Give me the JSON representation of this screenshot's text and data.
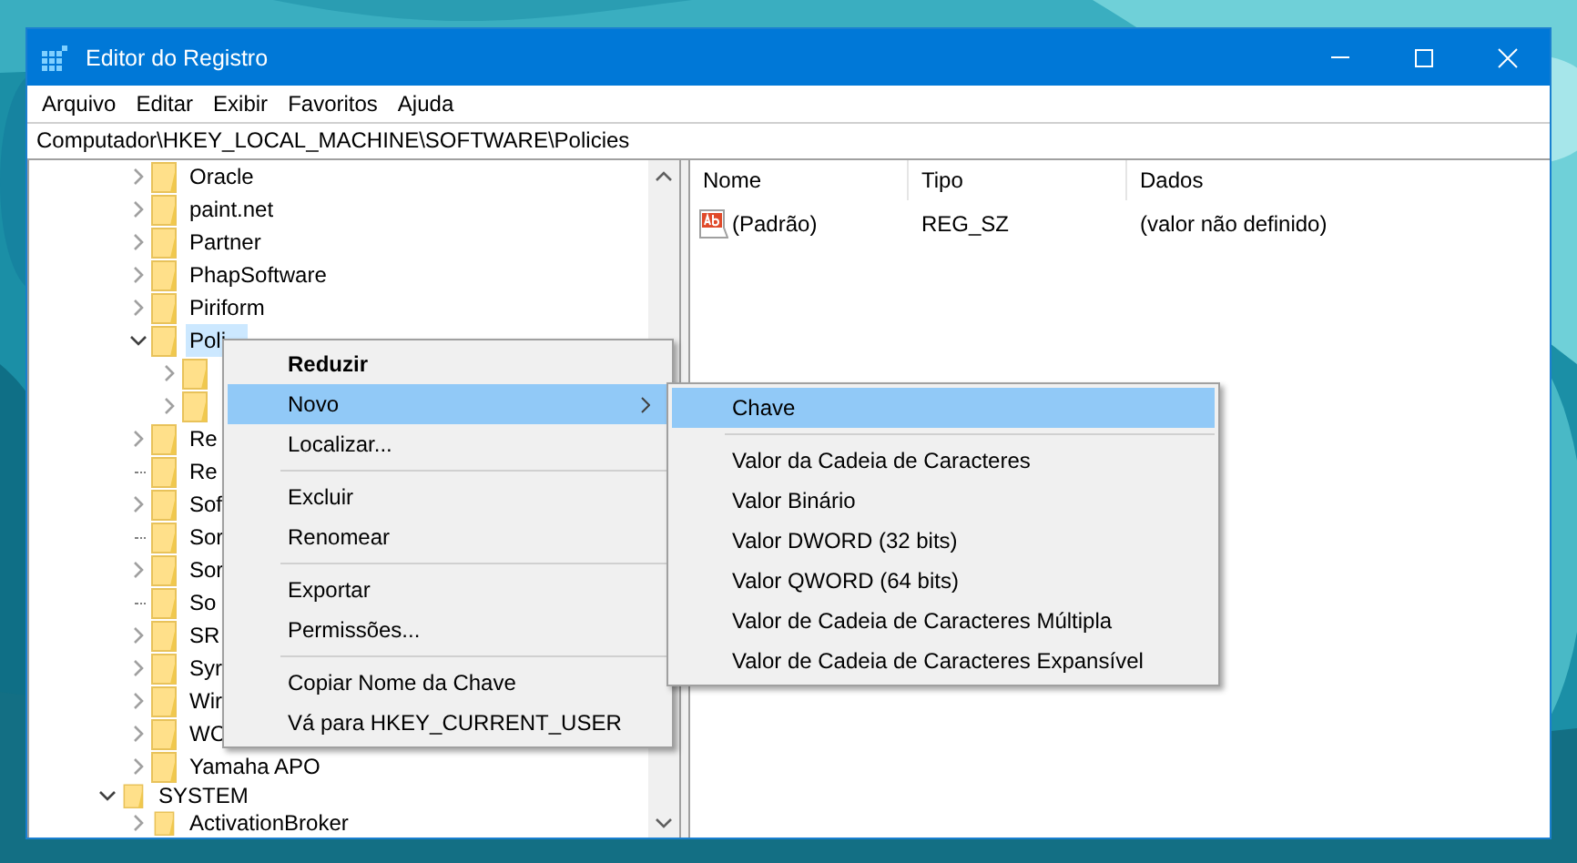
{
  "window": {
    "title": "Editor do Registro"
  },
  "menu_bar": [
    "Arquivo",
    "Editar",
    "Exibir",
    "Favoritos",
    "Ajuda"
  ],
  "address": "Computador\\HKEY_LOCAL_MACHINE\\SOFTWARE\\Policies",
  "tree": {
    "branches": [
      {
        "children": [
          {
            "label": "Oracle",
            "kind": "branch",
            "expanded": false,
            "selected": false
          },
          {
            "label": "paint.net",
            "kind": "branch",
            "expanded": false,
            "selected": false
          },
          {
            "label": "Partner",
            "kind": "branch",
            "expanded": false,
            "selected": false
          },
          {
            "label": "PhapSoftware",
            "kind": "branch",
            "expanded": false,
            "selected": false
          },
          {
            "label": "Piriform",
            "kind": "branch",
            "expanded": false,
            "selected": false
          },
          {
            "label": "Poli",
            "kind": "branch",
            "expanded": true,
            "selected": true,
            "children": [
              {
                "kind": "branch",
                "expanded": false
              },
              {
                "kind": "branch",
                "expanded": false
              }
            ]
          },
          {
            "label": "Re",
            "kind": "branch",
            "expanded": false,
            "selected": false
          },
          {
            "label": "Re",
            "kind": "leaf",
            "selected": false
          },
          {
            "label": "Sof",
            "kind": "branch",
            "expanded": false,
            "selected": false
          },
          {
            "label": "Sor",
            "kind": "leaf",
            "selected": false
          },
          {
            "label": "Sor",
            "kind": "branch",
            "expanded": false,
            "selected": false
          },
          {
            "label": "So",
            "kind": "leaf",
            "selected": false
          },
          {
            "label": "SR",
            "kind": "branch",
            "expanded": false,
            "selected": false
          },
          {
            "label": "Syr",
            "kind": "branch",
            "expanded": false,
            "selected": false
          },
          {
            "label": "Wir",
            "kind": "branch",
            "expanded": false,
            "selected": false
          },
          {
            "label": "WC",
            "kind": "branch",
            "expanded": false,
            "selected": false
          },
          {
            "label": "Yamaha APO",
            "kind": "branch",
            "expanded": false,
            "selected": false
          }
        ]
      },
      {
        "label": "SYSTEM",
        "kind": "branch",
        "expanded": true,
        "selected": false,
        "children": [
          {
            "label": "ActivationBroker",
            "kind": "branch",
            "expanded": false,
            "selected": false
          }
        ]
      }
    ]
  },
  "values_table": {
    "columns": [
      "Nome",
      "Tipo",
      "Dados"
    ],
    "rows": [
      {
        "name": "(Padrão)",
        "type": "REG_SZ",
        "data": "(valor não definido)"
      }
    ]
  },
  "context_menu": {
    "items": [
      {
        "kind": "item",
        "label": "Reduzir",
        "bold": true,
        "selected": false,
        "submenu": false
      },
      {
        "kind": "item",
        "label": "Novo",
        "bold": false,
        "selected": true,
        "submenu": true
      },
      {
        "kind": "item",
        "label": "Localizar...",
        "bold": false,
        "selected": false,
        "submenu": false
      },
      {
        "kind": "separator"
      },
      {
        "kind": "item",
        "label": "Excluir",
        "bold": false,
        "selected": false,
        "submenu": false
      },
      {
        "kind": "item",
        "label": "Renomear",
        "bold": false,
        "selected": false,
        "submenu": false
      },
      {
        "kind": "separator"
      },
      {
        "kind": "item",
        "label": "Exportar",
        "bold": false,
        "selected": false,
        "submenu": false
      },
      {
        "kind": "item",
        "label": "Permissões...",
        "bold": false,
        "selected": false,
        "submenu": false
      },
      {
        "kind": "separator"
      },
      {
        "kind": "item",
        "label": "Copiar Nome da Chave",
        "bold": false,
        "selected": false,
        "submenu": false
      },
      {
        "kind": "item",
        "label": "Vá para HKEY_CURRENT_USER",
        "bold": false,
        "selected": false,
        "submenu": false
      }
    ]
  },
  "submenu": {
    "items": [
      {
        "kind": "item",
        "label": "Chave",
        "bold": false,
        "selected": true,
        "submenu": false
      },
      {
        "kind": "separator"
      },
      {
        "kind": "item",
        "label": "Valor da Cadeia de Caracteres",
        "bold": false,
        "selected": false,
        "submenu": false
      },
      {
        "kind": "item",
        "label": "Valor Binário",
        "bold": false,
        "selected": false,
        "submenu": false
      },
      {
        "kind": "item",
        "label": "Valor DWORD (32 bits)",
        "bold": false,
        "selected": false,
        "submenu": false
      },
      {
        "kind": "item",
        "label": "Valor QWORD (64 bits)",
        "bold": false,
        "selected": false,
        "submenu": false
      },
      {
        "kind": "item",
        "label": "Valor de Cadeia de Caracteres Múltipla",
        "bold": false,
        "selected": false,
        "submenu": false
      },
      {
        "kind": "item",
        "label": "Valor de Cadeia de Caracteres Expansível",
        "bold": false,
        "selected": false,
        "submenu": false
      }
    ]
  }
}
